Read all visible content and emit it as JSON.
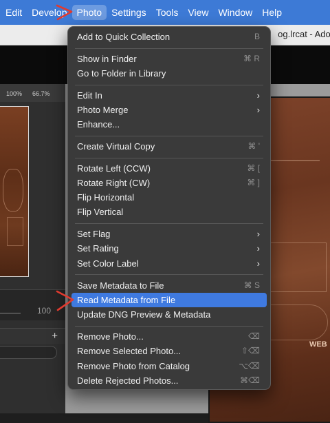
{
  "menubar": {
    "items": [
      "Edit",
      "Develop",
      "Photo",
      "Settings",
      "Tools",
      "View",
      "Window",
      "Help"
    ],
    "active_index": 2
  },
  "window": {
    "title_fragment": "og.lrcat - Adob"
  },
  "left_panel": {
    "zoom_labels": [
      "100%",
      "66.7%"
    ],
    "slider_value": "100",
    "add_icon": "plus-icon"
  },
  "menu": {
    "items": [
      {
        "label": "Add to Quick Collection",
        "shortcut": "B"
      },
      {
        "label": "Show in Finder",
        "shortcut": "⌘ R"
      },
      {
        "label": "Go to Folder in Library",
        "shortcut": ""
      },
      {
        "label": "Edit In",
        "submenu": true
      },
      {
        "label": "Photo Merge",
        "submenu": true
      },
      {
        "label": "Enhance...",
        "shortcut": ""
      },
      {
        "label": "Create Virtual Copy",
        "shortcut": "⌘ '"
      },
      {
        "label": "Rotate Left (CCW)",
        "shortcut": "⌘ ["
      },
      {
        "label": "Rotate Right (CW)",
        "shortcut": "⌘ ]"
      },
      {
        "label": "Flip Horizontal",
        "shortcut": ""
      },
      {
        "label": "Flip Vertical",
        "shortcut": ""
      },
      {
        "label": "Set Flag",
        "submenu": true
      },
      {
        "label": "Set Rating",
        "submenu": true
      },
      {
        "label": "Set Color Label",
        "submenu": true
      },
      {
        "label": "Save Metadata to File",
        "shortcut": "⌘ S"
      },
      {
        "label": "Read Metadata from File",
        "shortcut": "",
        "highlighted": true
      },
      {
        "label": "Update DNG Preview & Metadata",
        "shortcut": ""
      },
      {
        "label": "Remove Photo...",
        "shortcut": "⌫"
      },
      {
        "label": "Remove Selected Photo...",
        "shortcut": "⇧⌫"
      },
      {
        "label": "Remove Photo from Catalog",
        "shortcut": "⌥⌫"
      },
      {
        "label": "Delete Rejected Photos...",
        "shortcut": "⌘⌫"
      }
    ],
    "submenu_glyph": "›"
  },
  "photo": {
    "graffiti_text": "WEB"
  },
  "colors": {
    "menubar_blue": "#3d7ad6",
    "highlight_blue": "#3f7ae0",
    "menu_bg": "#3a3a3a",
    "annotation_red": "#e03a2f"
  }
}
